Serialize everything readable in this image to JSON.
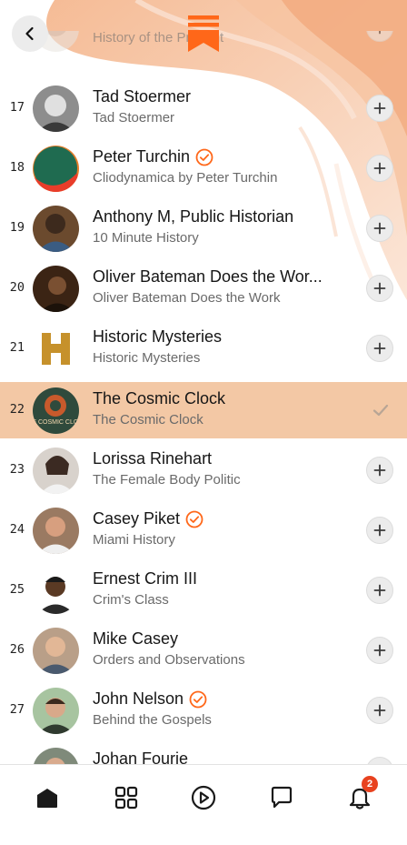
{
  "colors": {
    "accent": "#ff6719",
    "selected_row": "#f3c8a5",
    "badge": "#e8421f"
  },
  "header": {
    "back_icon": "chevron-left-icon",
    "logo_icon": "substack-logo-icon"
  },
  "rows": [
    {
      "rank": "",
      "name": "",
      "subtitle": "History of the Present",
      "verified": false,
      "selected": false
    },
    {
      "rank": "17",
      "name": "Tad Stoermer",
      "subtitle": "Tad Stoermer",
      "verified": false,
      "selected": false
    },
    {
      "rank": "18",
      "name": "Peter Turchin",
      "subtitle": "Cliodynamica by Peter Turchin",
      "verified": true,
      "selected": false
    },
    {
      "rank": "19",
      "name": "Anthony M, Public Historian",
      "subtitle": "10 Minute History",
      "verified": false,
      "selected": false
    },
    {
      "rank": "20",
      "name": "Oliver Bateman Does the Wor...",
      "subtitle": "Oliver Bateman Does the Work",
      "verified": false,
      "selected": false
    },
    {
      "rank": "21",
      "name": "Historic Mysteries",
      "subtitle": "Historic Mysteries",
      "verified": false,
      "selected": false
    },
    {
      "rank": "22",
      "name": "The Cosmic Clock",
      "subtitle": "The Cosmic Clock",
      "verified": false,
      "selected": true
    },
    {
      "rank": "23",
      "name": "Lorissa Rinehart",
      "subtitle": "The Female Body Politic",
      "verified": false,
      "selected": false
    },
    {
      "rank": "24",
      "name": "Casey Piket",
      "subtitle": "Miami History",
      "verified": true,
      "selected": false
    },
    {
      "rank": "25",
      "name": "Ernest Crim III",
      "subtitle": "Crim's Class",
      "verified": false,
      "selected": false
    },
    {
      "rank": "26",
      "name": "Mike Casey",
      "subtitle": "Orders and Observations",
      "verified": false,
      "selected": false
    },
    {
      "rank": "27",
      "name": "John Nelson",
      "subtitle": "Behind the Gospels",
      "verified": true,
      "selected": false
    },
    {
      "rank": "28",
      "name": "Johan Fourie",
      "subtitle": "",
      "verified": false,
      "selected": false
    }
  ],
  "tabbar": {
    "items": [
      {
        "icon": "home-icon"
      },
      {
        "icon": "grid-icon"
      },
      {
        "icon": "play-icon"
      },
      {
        "icon": "chat-icon"
      },
      {
        "icon": "bell-icon",
        "badge": "2"
      }
    ]
  }
}
